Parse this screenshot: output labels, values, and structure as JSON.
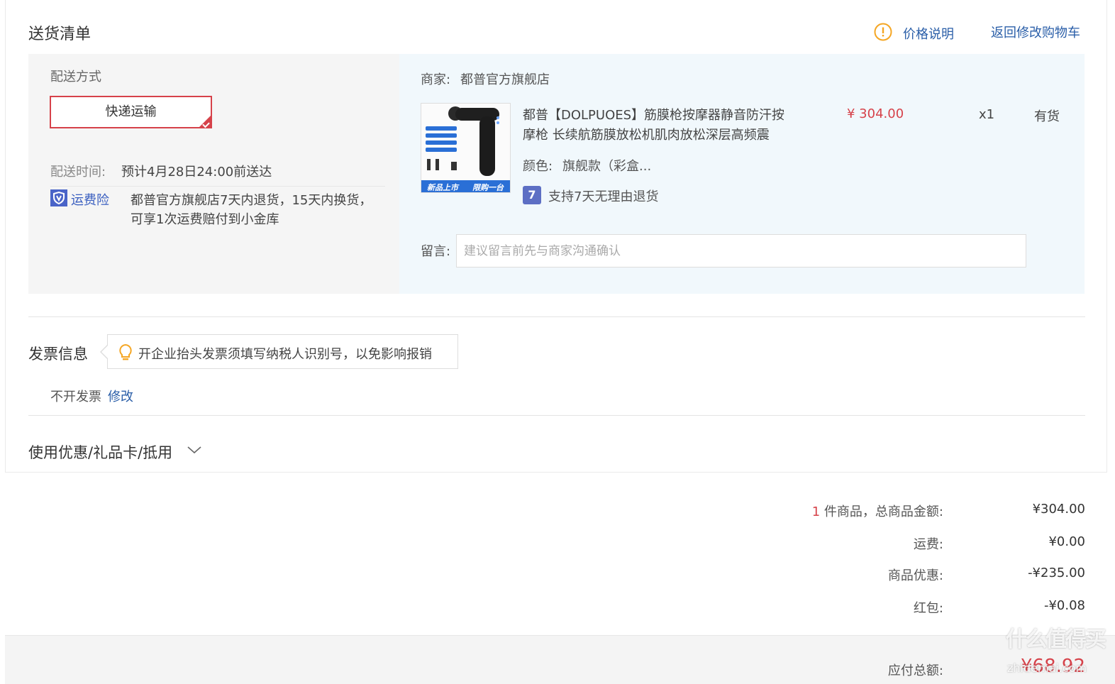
{
  "header": {
    "title": "送货清单",
    "price_note": "价格说明",
    "back_to_cart": "返回修改购物车"
  },
  "shipping": {
    "method_label": "配送方式",
    "method_option": "快递运输",
    "time_label": "配送时间:",
    "time_value": "预计4月28日24:00前送达",
    "insurance_label": "运费险",
    "insurance_text_line1": "都普官方旗舰店7天内退货，15天内换货，",
    "insurance_text_line2": "可享1次运费赔付到小金库"
  },
  "order": {
    "merchant_label": "商家:",
    "merchant_name": "都普官方旗舰店",
    "product": {
      "title_line1": "都普【DOLPUOES】筋膜枪按摩器静音防汗按",
      "title_line2": "摩枪 长续航筋膜放松机肌肉放松深层高频震",
      "color_label": "颜色:",
      "color_value": "旗舰款（彩盒...",
      "price": "¥ 304.00",
      "quantity": "x1",
      "stock": "有货",
      "return_badge": "7",
      "return_policy": "支持7天无理由退货",
      "image_banner_left": "新品上市",
      "image_banner_right": "限购一台"
    },
    "message_label": "留言:",
    "message_placeholder": "建议留言前先与商家沟通确认",
    "message_value": ""
  },
  "invoice": {
    "title": "发票信息",
    "tip": "开企业抬头发票须填写纳税人识别号，以免影响报销",
    "status": "不开发票",
    "edit": "修改"
  },
  "coupon": {
    "title": "使用优惠/礼品卡/抵用"
  },
  "summary": {
    "item_count": "1",
    "items_label": "件商品，总商品金额:",
    "items_total": "¥304.00",
    "shipping_label": "运费:",
    "shipping_value": "¥0.00",
    "discount_label": "商品优惠:",
    "discount_value": "-¥235.00",
    "redpacket_label": "红包:",
    "redpacket_value": "-¥0.08",
    "payable_label": "应付总额:",
    "payable_value": "¥68.92"
  },
  "watermark": {
    "text": "什么值得买",
    "domain": "zhidemai.com"
  },
  "colors": {
    "accent_red": "#d6424a",
    "link_blue": "#2a5ea8",
    "warn_orange": "#f5a623"
  }
}
